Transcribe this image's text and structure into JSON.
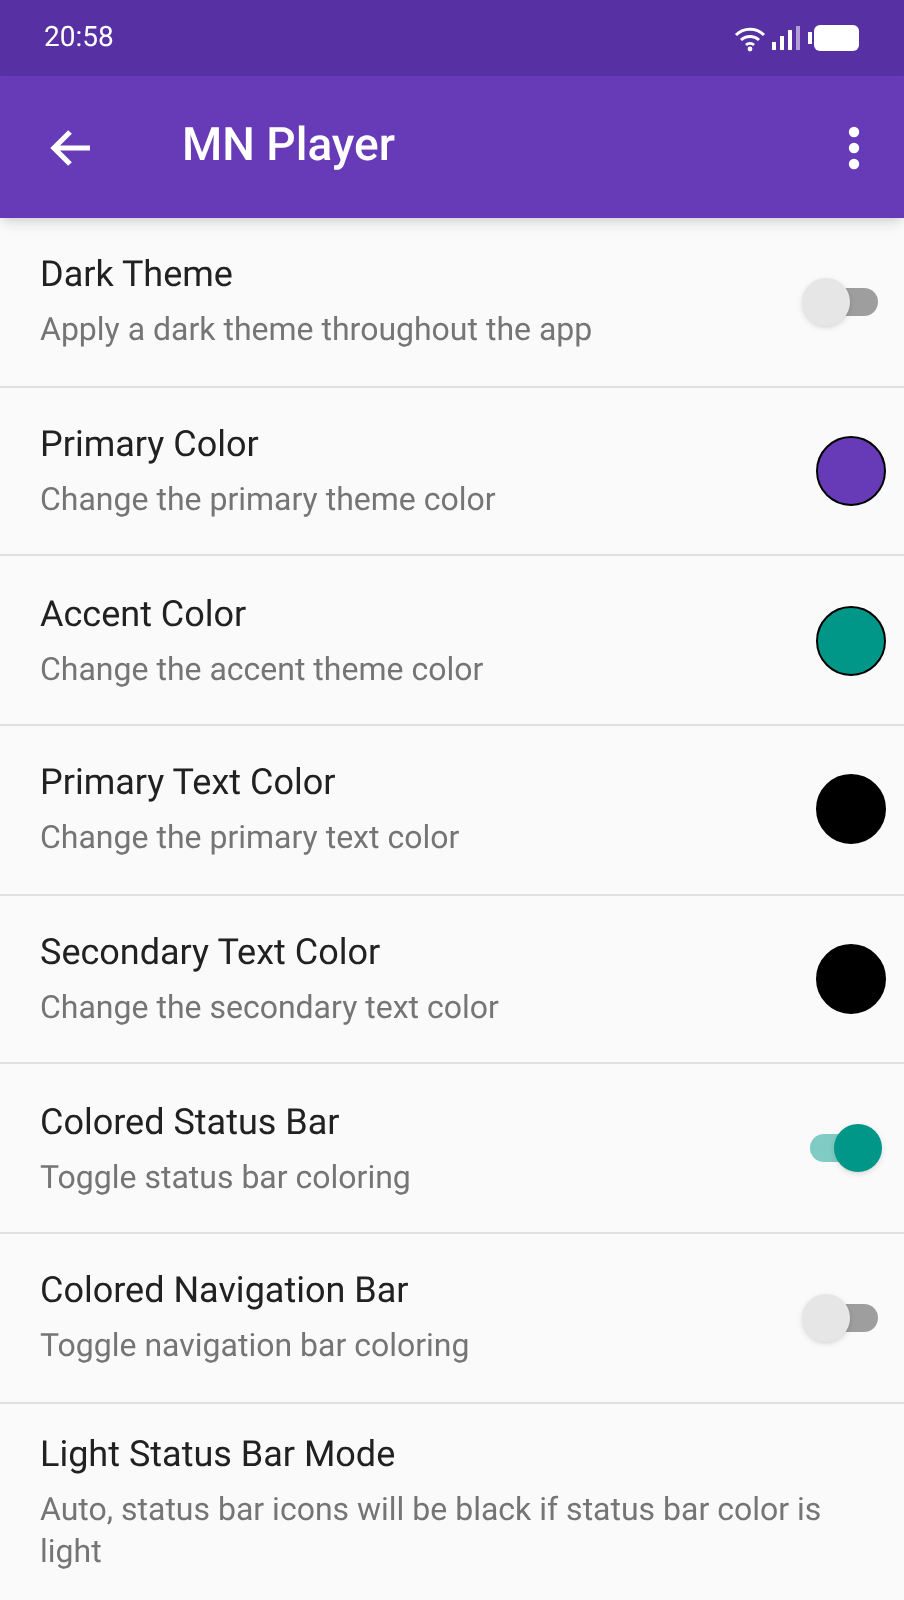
{
  "status_bar": {
    "time": "20:58"
  },
  "app_bar": {
    "title": "MN Player"
  },
  "settings": [
    {
      "kind": "switch",
      "title": "Dark Theme",
      "summary": "Apply a dark theme throughout the app",
      "on": false
    },
    {
      "kind": "color",
      "title": "Primary Color",
      "summary": "Change the primary theme color",
      "color": "#673ab7"
    },
    {
      "kind": "color",
      "title": "Accent Color",
      "summary": "Change the accent theme color",
      "color": "#009688"
    },
    {
      "kind": "color",
      "title": "Primary Text Color",
      "summary": "Change the primary text color",
      "color": "#000000"
    },
    {
      "kind": "color",
      "title": "Secondary Text Color",
      "summary": "Change the secondary text color",
      "color": "#000000"
    },
    {
      "kind": "switch",
      "title": "Colored Status Bar",
      "summary": "Toggle status bar coloring",
      "on": true
    },
    {
      "kind": "switch",
      "title": "Colored Navigation Bar",
      "summary": "Toggle navigation bar coloring",
      "on": false
    },
    {
      "kind": "text",
      "title": "Light Status Bar Mode",
      "summary": "Auto, status bar icons will be black if status bar color is light"
    }
  ]
}
